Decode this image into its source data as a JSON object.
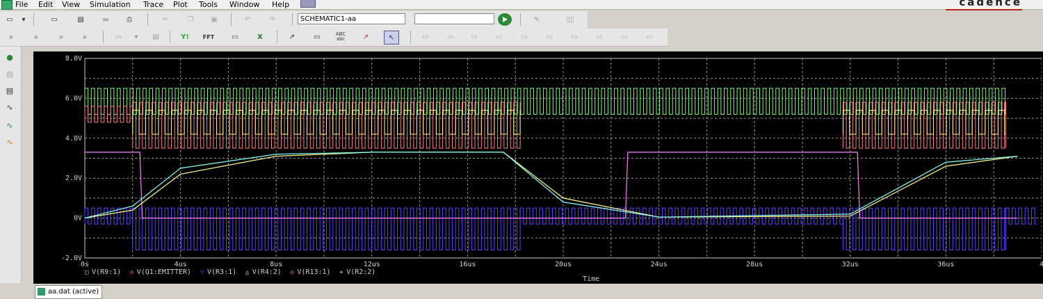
{
  "menubar": {
    "items": [
      "File",
      "Edit",
      "View",
      "Simulation",
      "Trace",
      "Plot",
      "Tools",
      "Window",
      "Help"
    ],
    "brand": "cādence"
  },
  "toolbar1": {
    "profile_value": "SCHEMATIC1-aa"
  },
  "toolbar2": {
    "label_fft": "FFT",
    "label_abc": "ABC abc"
  },
  "plot": {
    "y_ticks": [
      "8.0V",
      "6.0V",
      "4.0V",
      "2.0V",
      "0V",
      "-2.0V"
    ],
    "x_ticks": [
      "0s",
      "4us",
      "8us",
      "12us",
      "16us",
      "20us",
      "24us",
      "28us",
      "32us",
      "36us",
      "4"
    ],
    "x_axis_label": "Time",
    "legend": [
      {
        "symbol": "□",
        "label": "V(R9:1)",
        "color": "#80ff80"
      },
      {
        "symbol": "◇",
        "label": "V(Q1:EMITTER)",
        "color": "#ff8080"
      },
      {
        "symbol": "▽",
        "label": "V(R3:1)",
        "color": "#6040ff"
      },
      {
        "symbol": "△",
        "label": "V(R4:2)",
        "color": "#ffff80"
      },
      {
        "symbol": "◇",
        "label": "V(R13:1)",
        "color": "#ff80ff"
      },
      {
        "symbol": "+",
        "label": "V(R2:2)",
        "color": "#80ffff"
      }
    ]
  },
  "chart_data": {
    "type": "line",
    "title": "",
    "xlabel": "Time",
    "ylabel": "",
    "xlim": [
      0,
      40
    ],
    "x_unit": "us",
    "ylim": [
      -2.0,
      8.0
    ],
    "grid": true,
    "legend_position": "bottom-left",
    "series": [
      {
        "name": "V(R9:1)",
        "color": "#80ff80",
        "x": [
          0,
          2,
          18,
          32,
          38.5
        ],
        "values": [
          6.0,
          6.0,
          6.0,
          6.0,
          6.0
        ]
      },
      {
        "name": "V(Q1:EMITTER)",
        "color": "#ff8080",
        "x": [
          0,
          2,
          18,
          32,
          38.5
        ],
        "values": [
          4.8,
          4.5,
          4.5,
          4.5,
          4.5
        ]
      },
      {
        "name": "V(R3:1)",
        "color": "#6040ff",
        "x": [
          0,
          2,
          18,
          32,
          38.5
        ],
        "values": [
          0.2,
          -0.8,
          -0.8,
          -0.8,
          -0.8
        ]
      },
      {
        "name": "V(R4:2)",
        "color": "#ffff80",
        "x": [
          0,
          2,
          4,
          8,
          12,
          17.5,
          20,
          24,
          32,
          36,
          39
        ],
        "values": [
          0,
          0.4,
          2.2,
          3.1,
          3.3,
          3.3,
          1.0,
          0.05,
          0.1,
          2.6,
          3.1
        ]
      },
      {
        "name": "V(R13:1)",
        "color": "#ff80ff",
        "x": [
          0,
          2.3,
          2.4,
          22.6,
          22.7,
          32.3,
          32.4,
          39
        ],
        "values": [
          3.3,
          3.3,
          0,
          0,
          3.3,
          3.3,
          0,
          0
        ]
      },
      {
        "name": "V(R2:2)",
        "color": "#80ffff",
        "x": [
          0,
          2,
          4,
          8,
          12,
          17.5,
          20,
          24,
          32,
          36,
          39
        ],
        "values": [
          0,
          0.6,
          2.5,
          3.2,
          3.3,
          3.3,
          0.8,
          0.05,
          0.2,
          2.8,
          3.1
        ]
      }
    ]
  },
  "statusbar": {
    "tab_label": "aa.dat (active)"
  }
}
